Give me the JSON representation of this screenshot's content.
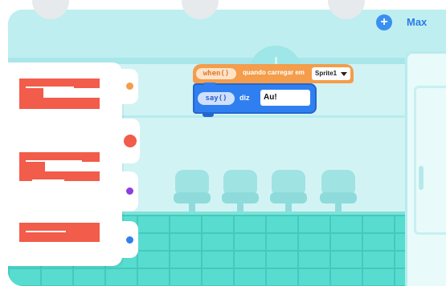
{
  "header": {
    "add_icon": "plus-icon",
    "user_label": "Max"
  },
  "blocks": {
    "hat": {
      "pill_label": "when()",
      "text": "quando carregar em",
      "dropdown_value": "Sprite1"
    },
    "say": {
      "pill_label": "say()",
      "text": "diz",
      "input_value": "Au!"
    }
  },
  "palette": {
    "tabs": [
      {
        "color": "#f49d4b"
      },
      {
        "color": "#f25c4a",
        "active": true
      },
      {
        "color": "#8b3fe0"
      },
      {
        "color": "#2f7ff0"
      }
    ]
  },
  "colors": {
    "hat_block": "#f49d4b",
    "say_block": "#2f7ff0",
    "code_block": "#f25c4a",
    "accent": "#2a7be8"
  }
}
